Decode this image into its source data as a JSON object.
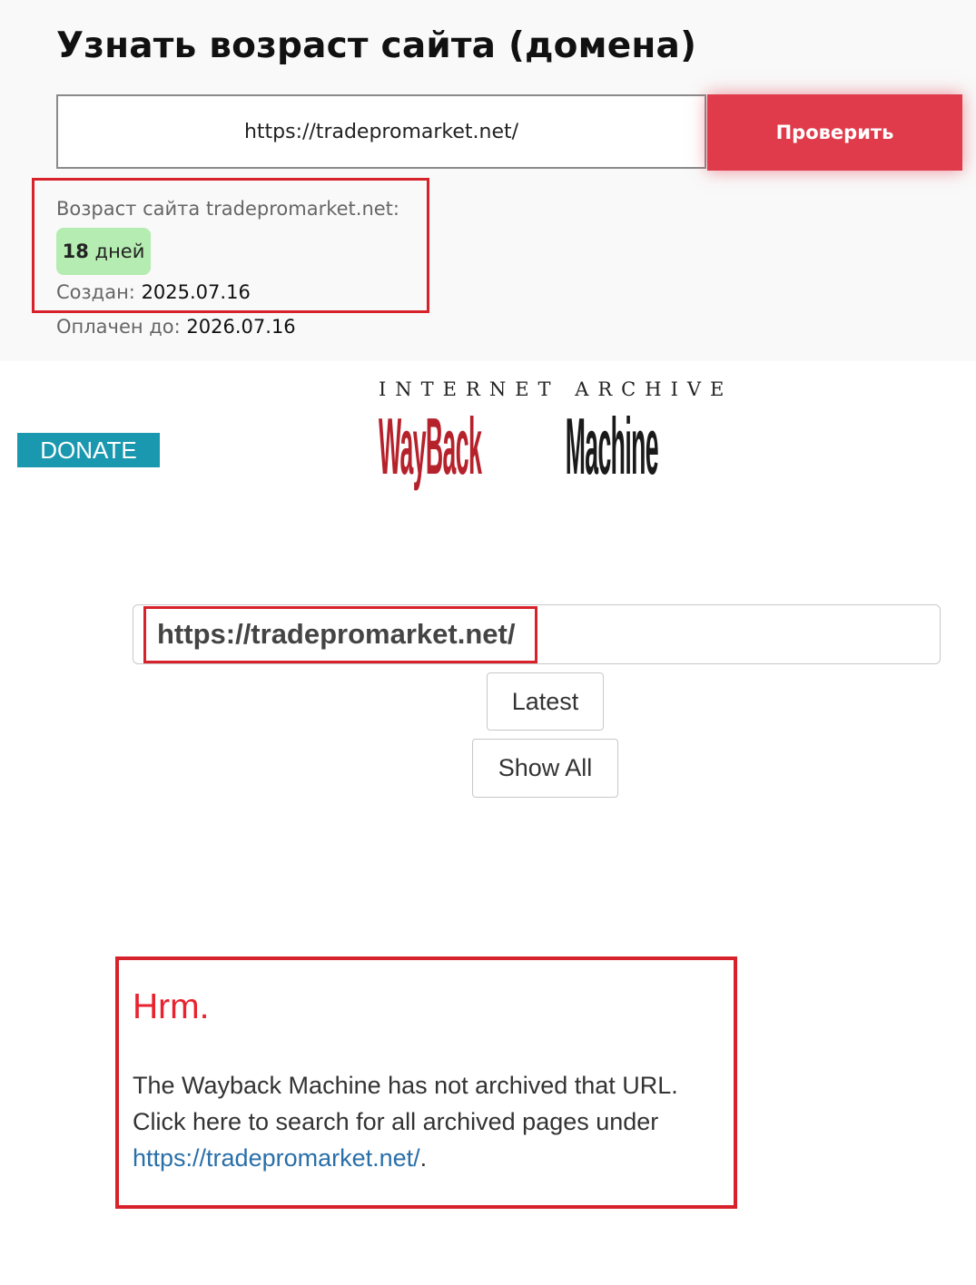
{
  "checker": {
    "title": "Узнать возраст сайта (домена)",
    "input_value": "https://tradepromarket.net/",
    "button_label": "Проверить",
    "age_label": "Возраст сайта tradepromarket.net:",
    "age_number": "18",
    "age_unit": "дней",
    "created_label": "Создан:",
    "created_value": "2025.07.16",
    "paid_label": "Оплачен до:",
    "paid_value": "2026.07.16"
  },
  "wayback": {
    "donate_label": "DONATE",
    "logo_top": "INTERNET ARCHIVE",
    "logo_word_red": "WayBack",
    "logo_word_dark": "Machine",
    "search_value": "https://tradepromarket.net/",
    "latest_label": "Latest",
    "show_all_label": "Show All",
    "message_title": "Hrm.",
    "message_line1": "The Wayback Machine has not archived that URL.",
    "message_line2": "Click here to search for all archived pages under",
    "message_link": "https://tradepromarket.net/",
    "message_period": "."
  },
  "colors": {
    "accent_red": "#e03b4b",
    "highlight_red": "#d8222b",
    "badge_green": "#b5ecb1",
    "donate_teal": "#1a98b0",
    "link_blue": "#2a6fa8"
  },
  "icons": []
}
